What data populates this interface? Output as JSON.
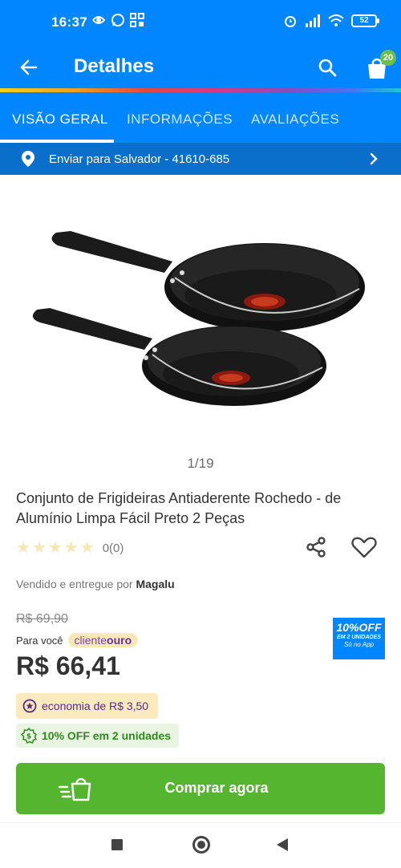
{
  "status_bar": {
    "time": "16:37",
    "battery": "52",
    "left_icons": [
      "nebula-icon",
      "whatsapp-icon",
      "grid-icon"
    ],
    "right_icons": [
      "alarm-icon",
      "signal-icon",
      "wifi-icon",
      "battery-icon"
    ]
  },
  "app_bar": {
    "title": "Detalhes",
    "cart_count": "20",
    "background": "#0086ff"
  },
  "tabs": [
    {
      "label": "VISÃO GERAL",
      "active": true
    },
    {
      "label": "INFORMAÇÕES",
      "active": false
    },
    {
      "label": "AVALIAÇÕES",
      "active": false
    }
  ],
  "shipping": {
    "text": "Enviar para Salvador - 41610-685"
  },
  "product": {
    "image_counter": "1/19",
    "title": "Conjunto de Frigideiras Antiaderente Rochedo - de Alumínio Limpa Fácil Preto 2 Peças",
    "rating_count": "0(0)",
    "stars": 0,
    "seller_prefix": "Vendido e entregue por",
    "seller_name": "Magalu",
    "old_price": "R$ 69,90",
    "para_voce": "Para você",
    "cliente_label": "cliente",
    "ouro_label": "ouro",
    "price": "R$ 66,41",
    "promo_badge": {
      "line1": "10%OFF",
      "line2": "EM 2 UNIDADES",
      "line3": "Só no App"
    },
    "economia": "economia de R$ 3,50",
    "desconto": "10% OFF em 2 unidades"
  },
  "buy_button": {
    "label": "Comprar agora",
    "color": "#55b52e"
  }
}
